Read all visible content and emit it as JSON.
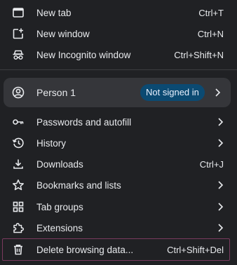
{
  "menu": {
    "top_items": [
      {
        "label": "New tab",
        "shortcut": "Ctrl+T",
        "icon": "new-tab-icon"
      },
      {
        "label": "New window",
        "shortcut": "Ctrl+N",
        "icon": "new-window-icon"
      },
      {
        "label": "New Incognito window",
        "shortcut": "Ctrl+Shift+N",
        "icon": "incognito-icon"
      }
    ],
    "profile": {
      "name": "Person 1",
      "status": "Not signed in",
      "icon": "account-circle-icon",
      "status_color": "#0b4a72"
    },
    "items": [
      {
        "label": "Passwords and autofill",
        "icon": "key-icon",
        "has_submenu": true
      },
      {
        "label": "History",
        "icon": "history-icon",
        "has_submenu": true
      },
      {
        "label": "Downloads",
        "shortcut": "Ctrl+J",
        "icon": "download-icon"
      },
      {
        "label": "Bookmarks and lists",
        "icon": "star-icon",
        "has_submenu": true
      },
      {
        "label": "Tab groups",
        "icon": "tab-groups-icon",
        "has_submenu": true
      },
      {
        "label": "Extensions",
        "icon": "extension-icon",
        "has_submenu": true
      },
      {
        "label": "Delete browsing data...",
        "shortcut": "Ctrl+Shift+Del",
        "icon": "trash-icon",
        "highlighted": true
      }
    ]
  },
  "colors": {
    "background": "#202124",
    "text": "#e8eaed",
    "card": "#35363a",
    "highlight_border": "#7a3a5e"
  }
}
